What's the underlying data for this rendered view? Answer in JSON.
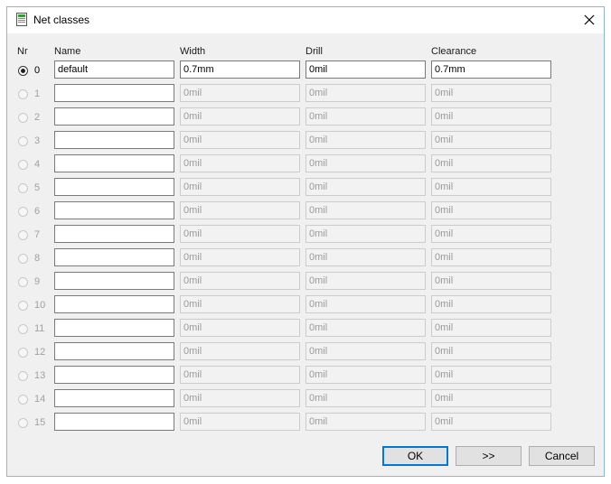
{
  "window": {
    "title": "Net classes"
  },
  "headers": {
    "nr": "Nr",
    "name": "Name",
    "width": "Width",
    "drill": "Drill",
    "clearance": "Clearance"
  },
  "rows": [
    {
      "nr": "0",
      "name": "default",
      "width": "0.7mm",
      "drill": "0mil",
      "clearance": "0.7mm",
      "selected": true,
      "enabled": true
    },
    {
      "nr": "1",
      "name": "",
      "width": "0mil",
      "drill": "0mil",
      "clearance": "0mil",
      "selected": false,
      "enabled": false
    },
    {
      "nr": "2",
      "name": "",
      "width": "0mil",
      "drill": "0mil",
      "clearance": "0mil",
      "selected": false,
      "enabled": false
    },
    {
      "nr": "3",
      "name": "",
      "width": "0mil",
      "drill": "0mil",
      "clearance": "0mil",
      "selected": false,
      "enabled": false
    },
    {
      "nr": "4",
      "name": "",
      "width": "0mil",
      "drill": "0mil",
      "clearance": "0mil",
      "selected": false,
      "enabled": false
    },
    {
      "nr": "5",
      "name": "",
      "width": "0mil",
      "drill": "0mil",
      "clearance": "0mil",
      "selected": false,
      "enabled": false
    },
    {
      "nr": "6",
      "name": "",
      "width": "0mil",
      "drill": "0mil",
      "clearance": "0mil",
      "selected": false,
      "enabled": false
    },
    {
      "nr": "7",
      "name": "",
      "width": "0mil",
      "drill": "0mil",
      "clearance": "0mil",
      "selected": false,
      "enabled": false
    },
    {
      "nr": "8",
      "name": "",
      "width": "0mil",
      "drill": "0mil",
      "clearance": "0mil",
      "selected": false,
      "enabled": false
    },
    {
      "nr": "9",
      "name": "",
      "width": "0mil",
      "drill": "0mil",
      "clearance": "0mil",
      "selected": false,
      "enabled": false
    },
    {
      "nr": "10",
      "name": "",
      "width": "0mil",
      "drill": "0mil",
      "clearance": "0mil",
      "selected": false,
      "enabled": false
    },
    {
      "nr": "11",
      "name": "",
      "width": "0mil",
      "drill": "0mil",
      "clearance": "0mil",
      "selected": false,
      "enabled": false
    },
    {
      "nr": "12",
      "name": "",
      "width": "0mil",
      "drill": "0mil",
      "clearance": "0mil",
      "selected": false,
      "enabled": false
    },
    {
      "nr": "13",
      "name": "",
      "width": "0mil",
      "drill": "0mil",
      "clearance": "0mil",
      "selected": false,
      "enabled": false
    },
    {
      "nr": "14",
      "name": "",
      "width": "0mil",
      "drill": "0mil",
      "clearance": "0mil",
      "selected": false,
      "enabled": false
    },
    {
      "nr": "15",
      "name": "",
      "width": "0mil",
      "drill": "0mil",
      "clearance": "0mil",
      "selected": false,
      "enabled": false
    }
  ],
  "buttons": {
    "ok": "OK",
    "next": ">>",
    "cancel": "Cancel"
  },
  "icons": {
    "app": "net-classes-app-icon",
    "close": "close-icon"
  },
  "colors": {
    "accent": "#0078d7",
    "window_border": "#8fb4d9",
    "dialog_bg": "#f0f0f0"
  }
}
